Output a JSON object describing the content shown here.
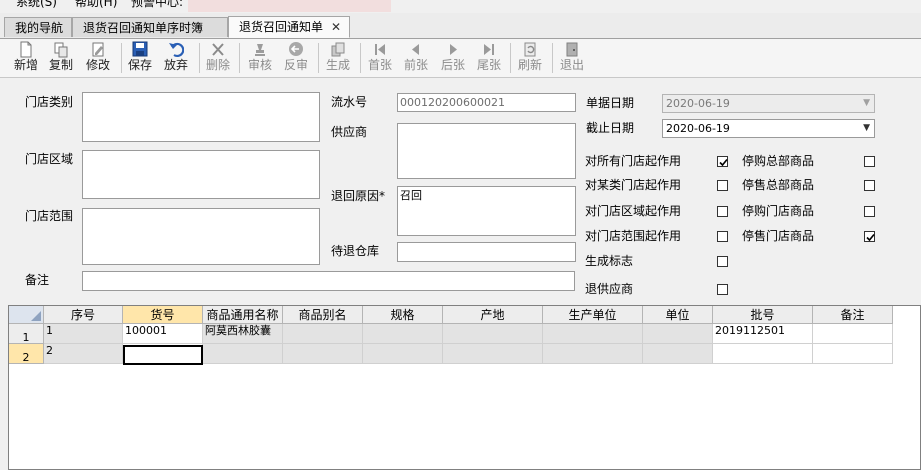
{
  "menu": {
    "system": "系统(S)",
    "help": "帮助(H)",
    "alert": "预警中心:"
  },
  "tabs": [
    {
      "label": "我的导航"
    },
    {
      "label": "退货召回通知单序时簿"
    },
    {
      "label": "退货召回通知单",
      "close": "✕"
    }
  ],
  "toolbar": {
    "new": "新增",
    "copy": "复制",
    "modify": "修改",
    "save": "保存",
    "discard": "放弃",
    "delete": "删除",
    "audit": "审核",
    "unaudit": "反审",
    "generate": "生成",
    "first": "首张",
    "prev": "前张",
    "next": "后张",
    "last": "尾张",
    "refresh": "刷新",
    "exit": "退出"
  },
  "form": {
    "store_category_label": "门店类别",
    "store_category": "",
    "store_region_label": "门店区域",
    "store_region": "",
    "store_scope_label": "门店范围",
    "store_scope": "",
    "remark_label": "备注",
    "remark": "",
    "serial_label": "流水号",
    "serial": "000120200600021",
    "supplier_label": "供应商",
    "supplier": "",
    "return_reason_label": "退回原因*",
    "return_reason": "召回",
    "warehouse_label": "待退仓库",
    "warehouse": "",
    "doc_date_label": "单据日期",
    "doc_date": "2020-06-19",
    "deadline_label": "截止日期",
    "deadline": "2020-06-19",
    "dropdown_arrow": "▼",
    "flags": [
      {
        "label": "对所有门店起作用",
        "checked": true
      },
      {
        "label": "对某类门店起作用",
        "checked": false
      },
      {
        "label": "对门店区域起作用",
        "checked": false
      },
      {
        "label": "对门店范围起作用",
        "checked": false
      },
      {
        "label": "生成标志",
        "checked": false
      },
      {
        "label": "退供应商",
        "checked": false
      }
    ],
    "flags2": [
      {
        "label": "停购总部商品",
        "checked": false
      },
      {
        "label": "停售总部商品",
        "checked": false
      },
      {
        "label": "停购门店商品",
        "checked": false
      },
      {
        "label": "停售门店商品",
        "checked": true
      }
    ]
  },
  "grid": {
    "columns": [
      "序号",
      "货号",
      "商品通用名称",
      "商品别名",
      "规格",
      "产地",
      "生产单位",
      "单位",
      "批号",
      "备注"
    ],
    "rows": [
      {
        "row_no": "1",
        "cells": [
          "1",
          "100001",
          "阿莫西林胶囊",
          "",
          "",
          "",
          "",
          "",
          "2019112501",
          ""
        ]
      },
      {
        "row_no": "2",
        "cells": [
          "2",
          "",
          "",
          "",
          "",
          "",
          "",
          "",
          "",
          ""
        ]
      }
    ]
  }
}
